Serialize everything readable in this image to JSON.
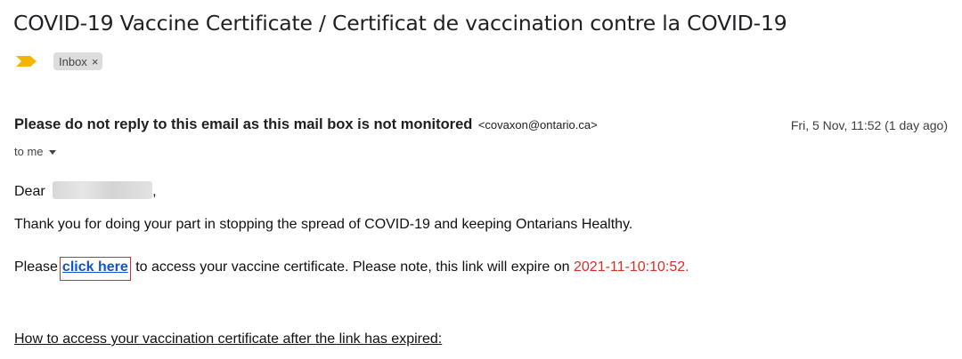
{
  "email": {
    "subject": "COVID-19 Vaccine Certificate / Certificat de vaccination contre la COVID-19",
    "labels": [
      {
        "label": "Inbox",
        "close": "×"
      }
    ],
    "sender_name": "Please do not reply to this email as this mail box is not monitored",
    "sender_email": "<covaxon@ontario.ca>",
    "date": "Fri, 5 Nov, 11:52 (1 day ago)",
    "to": "to me",
    "icons": {
      "importance": "importance-marker-icon",
      "recipients_toggle": "caret-down-icon"
    },
    "colors": {
      "importance_marker": "#f4b400",
      "link": "#1155cc",
      "link_highlight_border": "#d32f2f",
      "expiry_text": "#d93025"
    }
  },
  "body": {
    "greeting": "Dear",
    "greeting_suffix": ",",
    "thanks": "Thank you for doing your part in stopping the spread of COVID-19 and keeping Ontarians Healthy.",
    "please_prefix": "Please",
    "link_text": "click here",
    "please_suffix": "to access your vaccine certificate. Please note, this link will expire on",
    "expiry": "2021-11-10:10:52.",
    "how_to_heading": "How to access your vaccination certificate after the link has expired:"
  }
}
